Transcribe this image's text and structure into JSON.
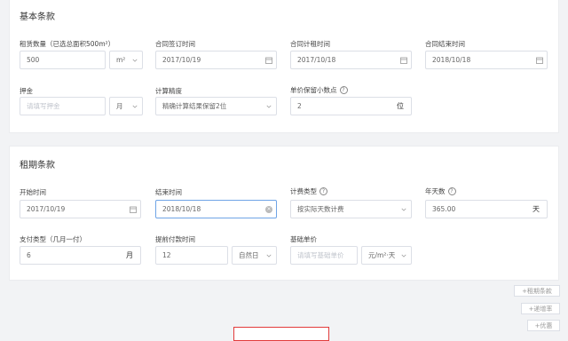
{
  "basic": {
    "title": "基本条款",
    "area_label": "租赁数量（已选总面积500m²）",
    "area_value": "500",
    "area_unit": "m²",
    "sign_label": "合同签订时间",
    "sign_value": "2017/10/19",
    "start_label": "合同计租时间",
    "start_value": "2017/10/18",
    "end_label": "合同结束时间",
    "end_value": "2018/10/18",
    "deposit_label": "押金",
    "deposit_placeholder": "请填写押金",
    "deposit_unit": "月",
    "precision_label": "计算精度",
    "precision_value": "精确计算结果保留2位",
    "decimals_label": "单价保留小数点",
    "decimals_value": "2",
    "decimals_suffix": "位"
  },
  "lease": {
    "title": "租期条款",
    "start_label": "开始时间",
    "start_value": "2017/10/19",
    "end_label": "结束时间",
    "end_value": "2018/10/18",
    "calc_type_label": "计费类型",
    "calc_type_value": "按实际天数计费",
    "year_days_label": "年天数",
    "year_days_value": "365.00",
    "year_days_suffix": "天",
    "pay_type_label": "支付类型（几月一付）",
    "pay_type_value": "6",
    "pay_type_suffix": "月",
    "advance_label": "提前付款时间",
    "advance_value": "12",
    "advance_unit": "自然日",
    "base_price_label": "基础单价",
    "base_price_placeholder": "请填写基础单价",
    "base_price_unit": "元/m²·天"
  },
  "actions": {
    "add_lease": "+租期条款",
    "add_increase": "+递增率",
    "add_discount": "+优惠"
  }
}
